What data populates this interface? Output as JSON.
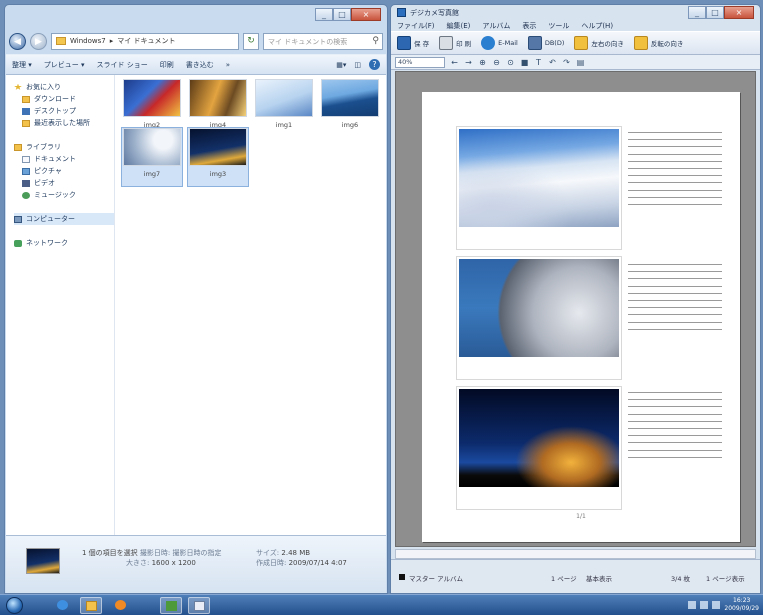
{
  "explorer": {
    "window_buttons": [
      "_",
      "□",
      "×"
    ],
    "address": {
      "path": [
        "Windows7",
        "マイ ドキュメント"
      ],
      "search_placeholder": "マイ ドキュメントの検索"
    },
    "toolbar": {
      "organize": "整理 ▾",
      "preview": "プレビュー ▾",
      "slideshow": "スライド ショー",
      "print": "印刷",
      "burn": "書き込む",
      "more": "»"
    },
    "nav": {
      "favorites_head": "お気に入り",
      "favorites": [
        "ダウンロード",
        "デスクトップ",
        "最近表示した場所"
      ],
      "libraries_head": "ライブラリ",
      "libraries": [
        "ドキュメント",
        "ピクチャ",
        "ビデオ",
        "ミュージック"
      ],
      "computer": "コンピューター",
      "network": "ネットワーク"
    },
    "files": [
      {
        "name": "img2"
      },
      {
        "name": "img4"
      },
      {
        "name": "img1"
      },
      {
        "name": "img6"
      },
      {
        "name": "img7"
      },
      {
        "name": "img3"
      }
    ],
    "details": {
      "selection": "1 個の項目を選択",
      "date_taken_label": "撮影日時:",
      "date_taken": "撮影日時の指定",
      "dimensions_label": "大きさ:",
      "dimensions": "1600 x 1200",
      "size_label": "サイズ:",
      "size": "2.48 MB",
      "created_label": "作成日時:",
      "created": "2009/07/14 4:07"
    }
  },
  "viewer": {
    "title": "デジカメ写真館",
    "window_buttons": [
      "_",
      "□",
      "×"
    ],
    "menu": [
      "ファイル(F)",
      "編集(E)",
      "アルバム",
      "表示",
      "ツール",
      "ヘルプ(H)"
    ],
    "toolbar": [
      "保 存",
      "印 刷",
      "E-Mail",
      "DB(D)",
      "左右の向き",
      "反転の向き"
    ],
    "zoom": "40%",
    "page_number": "1/1",
    "status": {
      "style": "マスター アルバム",
      "page": "1 ページ",
      "mode": "基本表示",
      "count": "3/4 枚",
      "layout": "1 ページ表示"
    }
  },
  "taskbar": {
    "clock_time": "16:23",
    "clock_date": "2009/09/29"
  }
}
